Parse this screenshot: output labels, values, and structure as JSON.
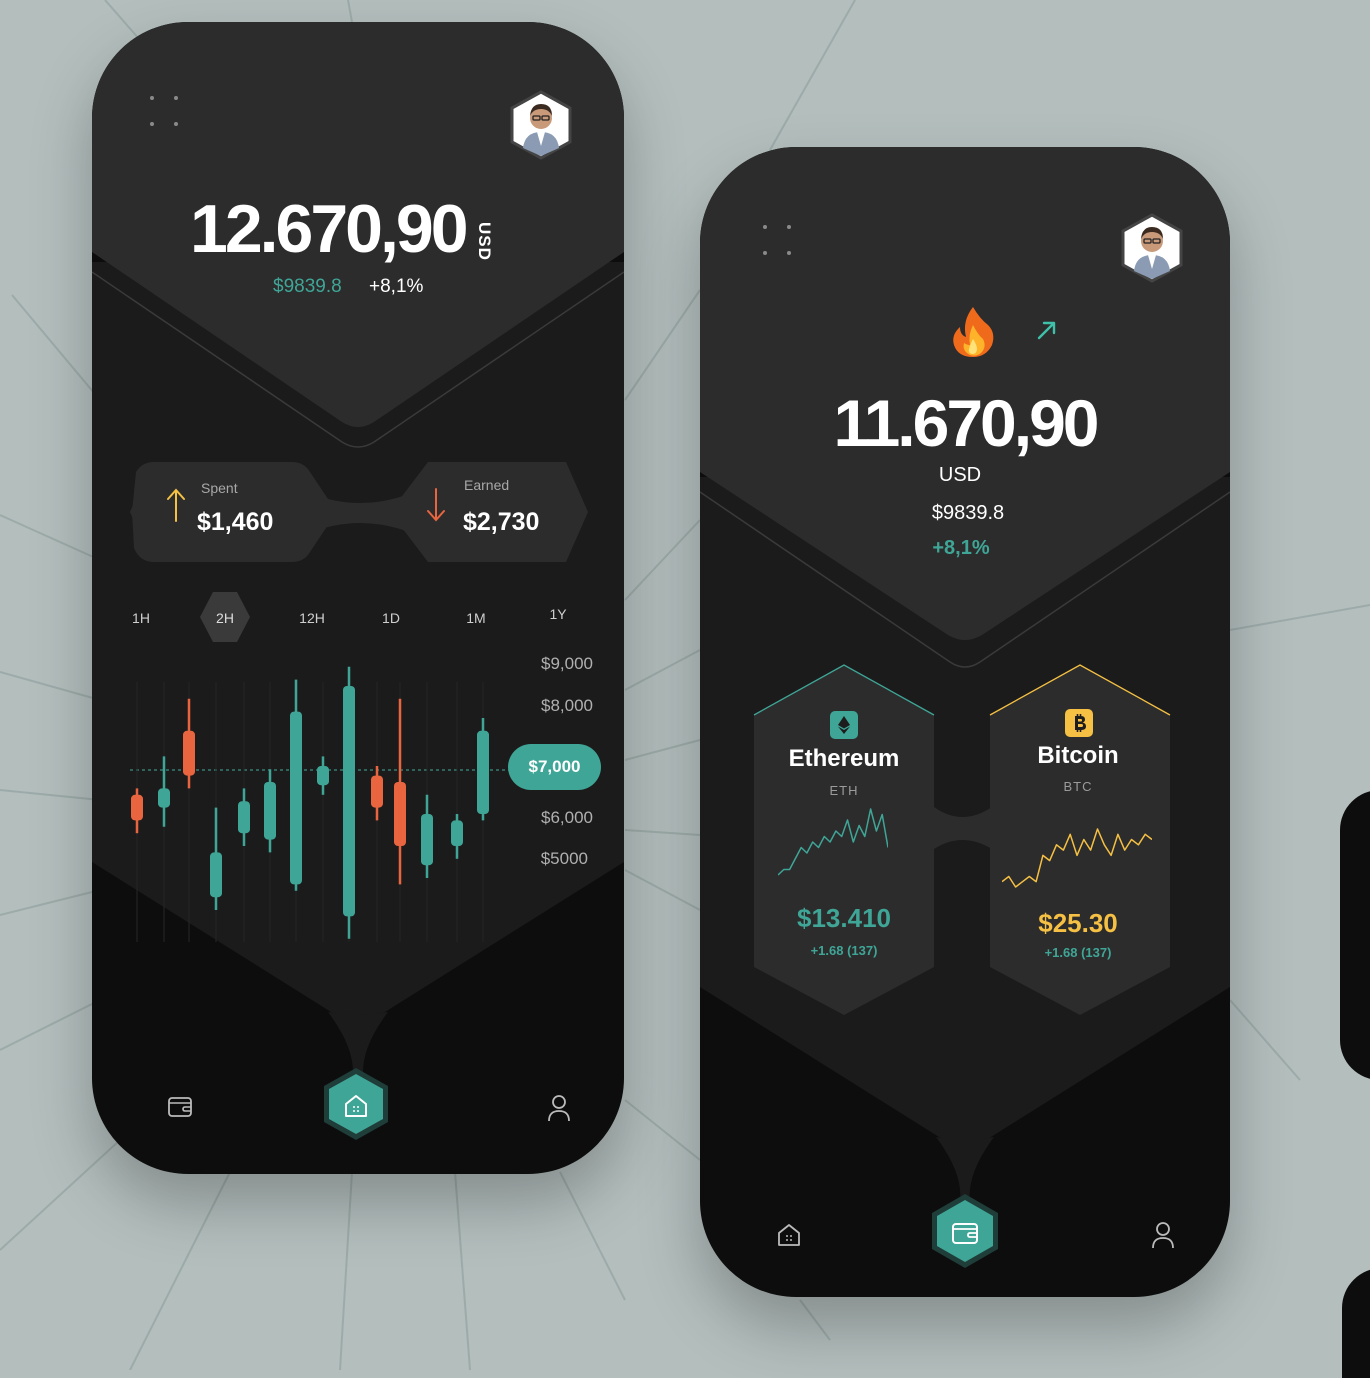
{
  "colors": {
    "background": "#b3bebd",
    "phone": "#0d0d0d",
    "panel_top": "#2c2c2c",
    "panel_mid": "#1d1d1d",
    "accent_teal": "#3fa697",
    "accent_orange": "#e8653f",
    "accent_yellow": "#f5c043"
  },
  "screen1": {
    "balance": "12.670,90",
    "currency": "USD",
    "sub_value": "$9839.8",
    "change": "+8,1%",
    "spent": {
      "label": "Spent",
      "amount": "$1,460",
      "icon": "arrow-up-icon"
    },
    "earned": {
      "label": "Earned",
      "amount": "$2,730",
      "icon": "arrow-down-icon"
    },
    "timeframes": [
      "1H",
      "2H",
      "12H",
      "1D",
      "1M",
      "1Y"
    ],
    "active_timeframe": "2H",
    "current_price": "$7,000",
    "nav": {
      "left_icon": "wallet-icon",
      "center_icon": "home-icon",
      "right_icon": "user-icon"
    }
  },
  "chart_data": {
    "type": "candlestick",
    "y_tick_labels": [
      "$9,000",
      "$8,000",
      "$6,000",
      "$5000"
    ],
    "current_price_label": "$7,000",
    "ylim": [
      4500,
      9500
    ],
    "candles": [
      {
        "open": 6400,
        "close": 6800,
        "high": 6900,
        "low": 6200,
        "dir": "down"
      },
      {
        "open": 6600,
        "close": 6900,
        "high": 7400,
        "low": 6300,
        "dir": "up"
      },
      {
        "open": 7800,
        "close": 7100,
        "high": 8300,
        "low": 6900,
        "dir": "down"
      },
      {
        "open": 5200,
        "close": 5900,
        "high": 6600,
        "low": 5000,
        "dir": "up"
      },
      {
        "open": 6200,
        "close": 6700,
        "high": 6900,
        "low": 6000,
        "dir": "up"
      },
      {
        "open": 6100,
        "close": 7000,
        "high": 7200,
        "low": 5900,
        "dir": "up"
      },
      {
        "open": 5400,
        "close": 8100,
        "high": 8600,
        "low": 5300,
        "dir": "up"
      },
      {
        "open": 6950,
        "close": 7250,
        "high": 7400,
        "low": 6800,
        "dir": "up"
      },
      {
        "open": 4900,
        "close": 8500,
        "high": 8800,
        "low": 4550,
        "dir": "up"
      },
      {
        "open": 7100,
        "close": 6600,
        "high": 7250,
        "low": 6400,
        "dir": "down"
      },
      {
        "open": 7000,
        "close": 6000,
        "high": 8300,
        "low": 5400,
        "dir": "down"
      },
      {
        "open": 5700,
        "close": 6500,
        "high": 6800,
        "low": 5500,
        "dir": "up"
      },
      {
        "open": 6000,
        "close": 6400,
        "high": 6500,
        "low": 5800,
        "dir": "up"
      },
      {
        "open": 6500,
        "close": 7800,
        "high": 8000,
        "low": 6400,
        "dir": "up"
      }
    ]
  },
  "screen2": {
    "balance": "11.670,90",
    "currency": "USD",
    "sub_value": "$9839.8",
    "change": "+8,1%",
    "fire_icon": "fire-icon",
    "trend_icon": "arrow-up-right-icon",
    "coins": [
      {
        "name": "Ethereum",
        "symbol": "ETH",
        "price": "$13.410",
        "change": "+1.68 (137)",
        "icon": "ethereum-icon",
        "color": "#3fa697",
        "sparkline": [
          2,
          3,
          3,
          5,
          7,
          6,
          8,
          7,
          9,
          8,
          10,
          9,
          12,
          8,
          11,
          9,
          14,
          10,
          13,
          7
        ]
      },
      {
        "name": "Bitcoin",
        "symbol": "BTC",
        "price": "$25.30",
        "change": "+1.68 (137)",
        "icon": "bitcoin-icon",
        "color": "#f5c043",
        "sparkline": [
          3,
          4,
          2,
          3,
          4,
          3,
          8,
          7,
          10,
          9,
          12,
          8,
          11,
          9,
          13,
          10,
          8,
          12,
          9,
          11,
          10,
          12,
          11
        ]
      }
    ],
    "nav": {
      "left_icon": "home-icon",
      "center_icon": "wallet-icon",
      "right_icon": "user-icon"
    }
  }
}
